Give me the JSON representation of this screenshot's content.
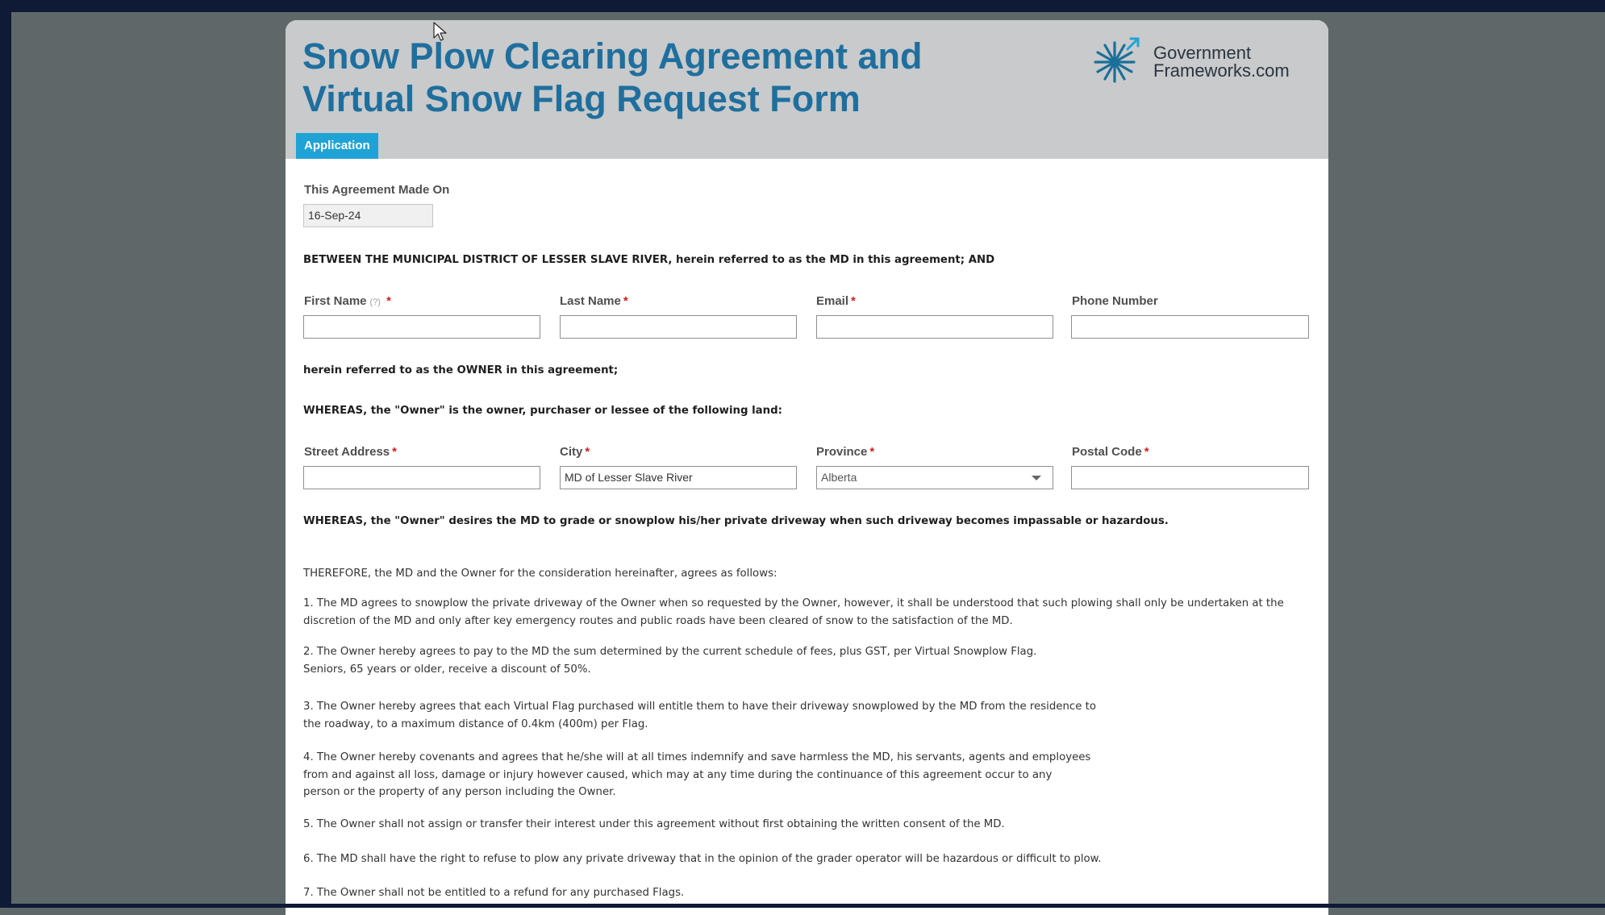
{
  "header": {
    "title": "Snow Plow Clearing Agreement and Virtual Snow Flag Request Form",
    "logo_line1": "Government",
    "logo_line2": "Frameworks.com",
    "tab_label": "Application"
  },
  "agreement_date": {
    "label": "This Agreement Made On",
    "value": "16-Sep-24"
  },
  "between_text": "BETWEEN THE MUNICIPAL DISTRICT OF LESSER SLAVE RIVER, herein referred to as the MD in this agreement; AND",
  "owner_fields": {
    "first_name_label": "First Name",
    "first_name_help": "(?)",
    "last_name_label": "Last Name",
    "email_label": "Email",
    "phone_label": "Phone Number",
    "required_mark": "*"
  },
  "owner_text": "herein referred to as the OWNER in this agreement;",
  "whereas_land": "WHEREAS, the \"Owner\" is the owner, purchaser or lessee of the following land:",
  "address_fields": {
    "street_label": "Street Address",
    "city_label": "City",
    "city_value": "MD of Lesser Slave River",
    "province_label": "Province",
    "province_value": "Alberta",
    "postal_label": "Postal Code"
  },
  "whereas_desire": "WHEREAS, the \"Owner\" desires the MD to grade or snowplow his/her private driveway when such driveway becomes impassable or hazardous.",
  "therefore": "THEREFORE, the MD and the Owner for the consideration hereinafter, agrees as follows:",
  "clauses": [
    {
      "line1": "1. The MD agrees to snowplow the private driveway of the Owner when so requested by the Owner, however, it shall be understood that such plowing shall only be undertaken at the",
      "line2": "discretion of the MD and only after key emergency routes and public roads have been cleared of snow to the satisfaction of the MD."
    },
    {
      "line1": "2. The Owner hereby agrees to pay to the MD the sum determined by the current schedule of fees, plus GST, per Virtual Snowplow Flag.",
      "line2": "Seniors, 65 years or older, receive a discount of 50%."
    },
    {
      "line1": "3. The Owner hereby agrees that each Virtual Flag purchased will entitle them to have their driveway snowplowed by the MD from the residence to",
      "line2": "the roadway, to a maximum distance of 0.4km (400m) per Flag."
    },
    {
      "line1": "4. The Owner hereby covenants and agrees that he/she will at all times indemnify and save harmless the MD, his servants, agents and employees",
      "line2": "from and against all loss, damage or injury however caused, which may at any time during the continuance of this agreement occur to any",
      "line3": "person or the property of any person including the Owner."
    },
    {
      "line1": "5. The Owner shall not assign or transfer their interest under this agreement without first obtaining the written consent of the MD."
    },
    {
      "line1": "6. The MD shall have the right to refuse to plow any private driveway that in the opinion of the grader operator will be hazardous or difficult to plow."
    },
    {
      "line1": "7. The Owner shall not be entitled to a refund for any purchased Flags."
    }
  ],
  "colors": {
    "title": "#1f6f9e",
    "tab": "#1fa3d6",
    "header_bg": "#c8cacb",
    "required": "#cc1f1f",
    "backdrop": "#5e6868",
    "frame": "#0e1a36"
  }
}
